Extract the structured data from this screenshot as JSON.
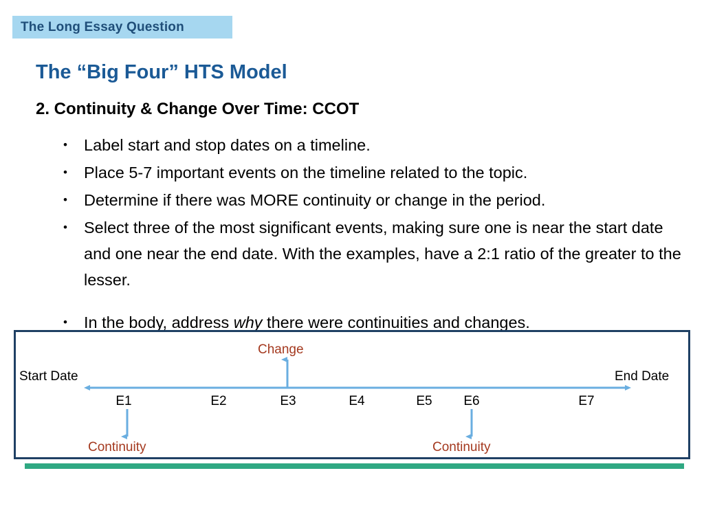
{
  "header": {
    "banner_text": "The Long Essay Question",
    "banner_bg": "#a6d7f0",
    "banner_color": "#1f4e79"
  },
  "slide": {
    "title": "The “Big Four” HTS Model",
    "title_color": "#1b5a96",
    "subtitle": "2. Continuity & Change Over Time: CCOT"
  },
  "bullets": [
    {
      "marker": "•",
      "text": "Label start and stop dates on a timeline."
    },
    {
      "marker": "•",
      "text": "Place 5-7 important events on the timeline related to the topic."
    },
    {
      "marker": "•",
      "text": "Determine if there was MORE continuity or change in the period."
    },
    {
      "marker": "•",
      "text": "Select three of the most significant events, making sure one is near the start date and one near the end date. With the examples, have a 2:1 ratio of the greater to the lesser."
    }
  ],
  "final_bullet": {
    "marker": "•",
    "text_before": "In the body, address ",
    "emphasis": "why",
    "text_after": " there were continuities and changes."
  },
  "diagram": {
    "border_color": "#1f4064",
    "arrow_color": "#6aaee0",
    "accent_bar_color": "#2fa882",
    "start_label": "Start Date",
    "end_label": "End Date",
    "change_label": "Change",
    "continuity_label_left": "Continuity",
    "continuity_label_right": "Continuity",
    "events": [
      {
        "label": "E1"
      },
      {
        "label": "E2"
      },
      {
        "label": "E3"
      },
      {
        "label": "E4"
      },
      {
        "label": "E5"
      },
      {
        "label": "E6"
      },
      {
        "label": "E7"
      }
    ]
  }
}
